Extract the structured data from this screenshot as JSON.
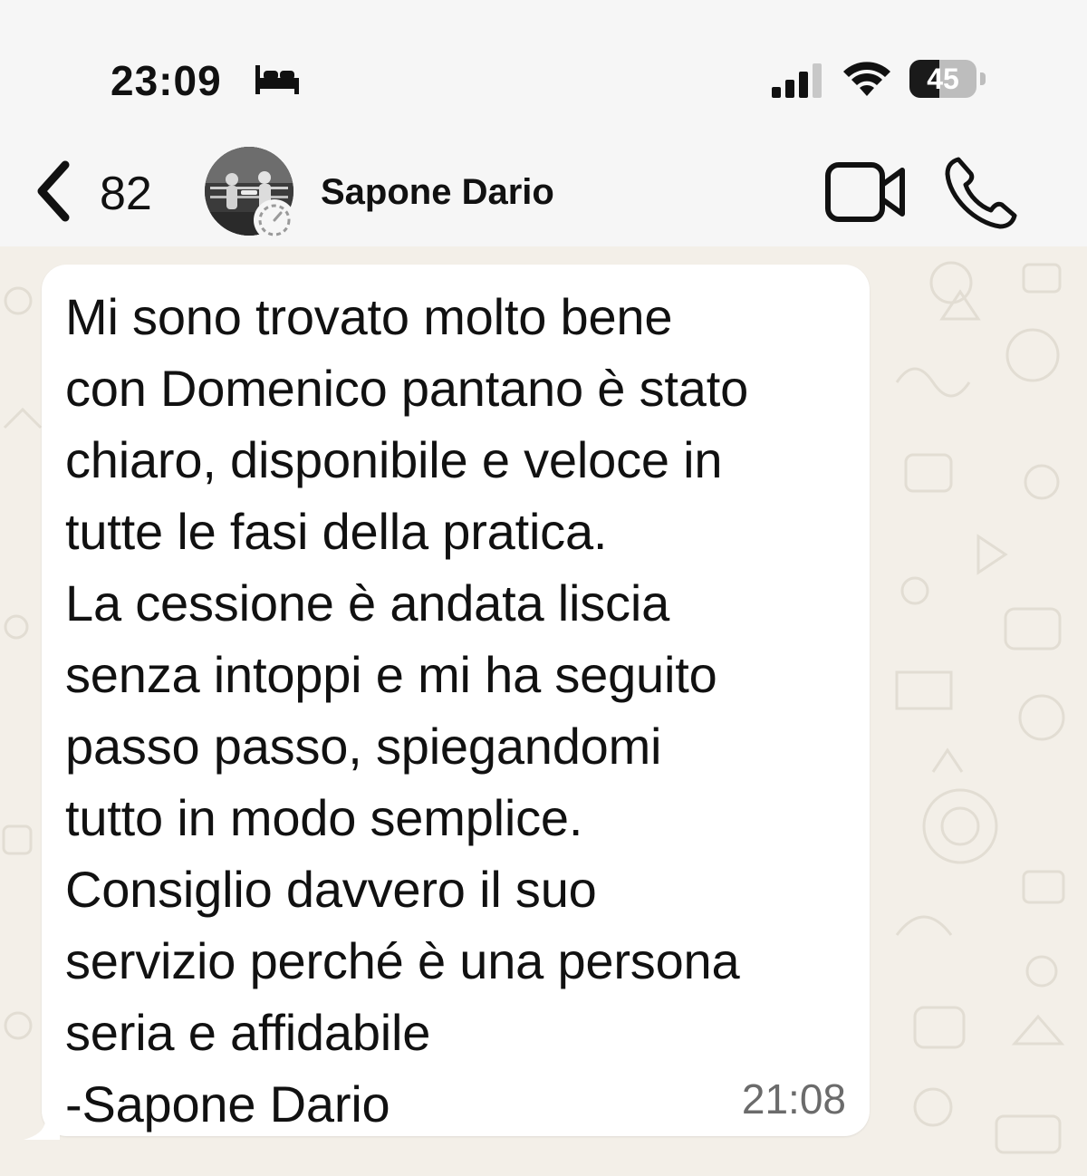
{
  "status_bar": {
    "time": "23:09",
    "sleep_icon": "bed-icon",
    "signal_icon": "cellular-signal-icon",
    "wifi_icon": "wifi-icon",
    "battery": {
      "level": "45",
      "fraction": 0.45
    }
  },
  "header": {
    "back_icon": "chevron-left-icon",
    "back_count": "82",
    "contact_name": "Sapone Dario",
    "video_icon": "video-camera-icon",
    "call_icon": "phone-icon"
  },
  "message": {
    "text": "Mi sono trovato molto bene\ncon Domenico pantano è stato\nchiaro, disponibile e veloce in\ntutte le fasi della pratica.\nLa cessione è andata liscia\nsenza intoppi e mi ha seguito\npasso passo, spiegandomi\ntutto in modo semplice.\nConsiglio davvero il suo\nservizio perché è una persona\nseria e affidabile\n-Sapone Dario",
    "time": "21:08"
  },
  "colors": {
    "bubble": "#ffffff",
    "chat_background": "#f3efe8",
    "header_background": "#f6f6f6",
    "time_text": "#6b6b6b"
  }
}
